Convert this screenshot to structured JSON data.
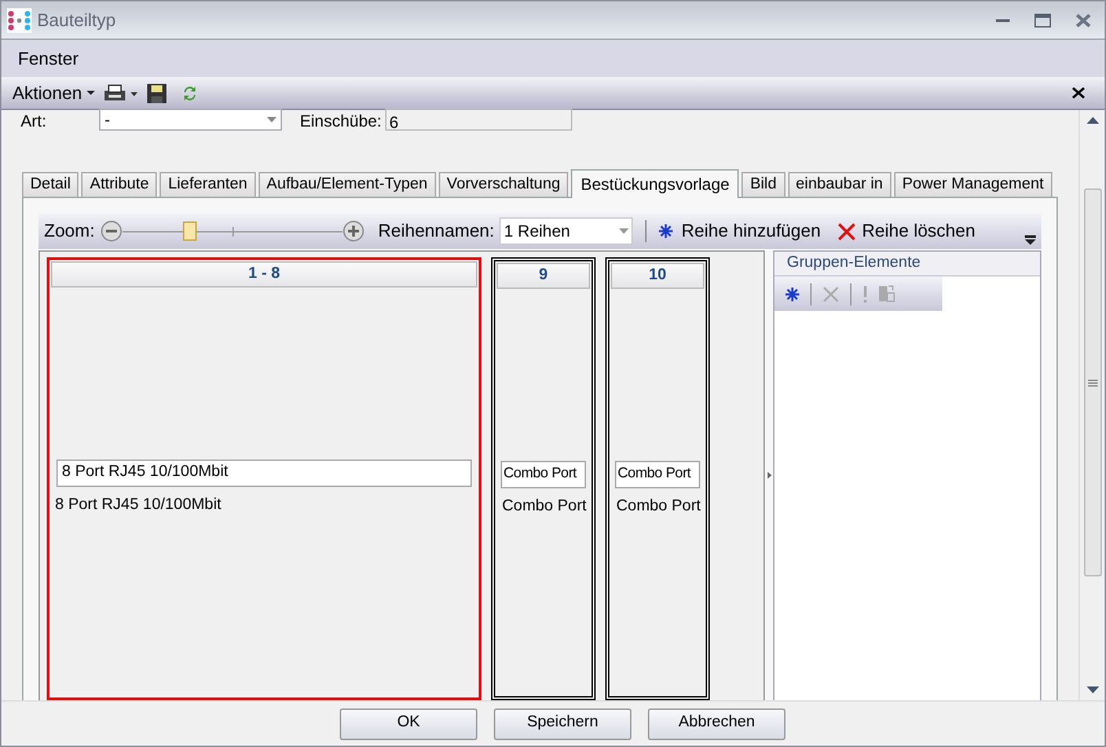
{
  "window": {
    "title": "Bauteiltyp"
  },
  "menu": [
    "Fenster"
  ],
  "toolbar": {
    "actions_label": "Aktionen"
  },
  "form": {
    "art_label": "Art:",
    "art_value": "-",
    "einschuebe_label": "Einschübe:",
    "einschuebe_value": "6"
  },
  "tabs": [
    {
      "label": "Detail",
      "selected": false
    },
    {
      "label": "Attribute",
      "selected": false
    },
    {
      "label": "Lieferanten",
      "selected": false
    },
    {
      "label": "Aufbau/Element-Typen",
      "selected": false
    },
    {
      "label": "Vorverschaltung",
      "selected": false
    },
    {
      "label": "Bestückungsvorlage",
      "selected": true
    },
    {
      "label": "Bild",
      "selected": false
    },
    {
      "label": "einbaubar in",
      "selected": false
    },
    {
      "label": "Power Management",
      "selected": false
    }
  ],
  "panel_toolbar": {
    "zoom_label": "Zoom:",
    "zoom": {
      "level": 0.31
    },
    "rows_label": "Reihennamen:",
    "rows_value": "1 Reihen",
    "add_row": "Reihe hinzufügen",
    "delete_row": "Reihe löschen"
  },
  "slots": [
    {
      "header": "1 - 8",
      "value": "8 Port RJ45 10/100Mbit",
      "caption": "8 Port RJ45 10/100Mbit",
      "selected": true
    },
    {
      "header": "9",
      "value": "Combo Port",
      "caption": "Combo Port",
      "selected": false
    },
    {
      "header": "10",
      "value": "Combo Port",
      "caption": "Combo Port",
      "selected": false
    }
  ],
  "group_panel": {
    "title": "Gruppen-Elemente"
  },
  "buttons": [
    "OK",
    "Speichern",
    "Abbrechen"
  ]
}
